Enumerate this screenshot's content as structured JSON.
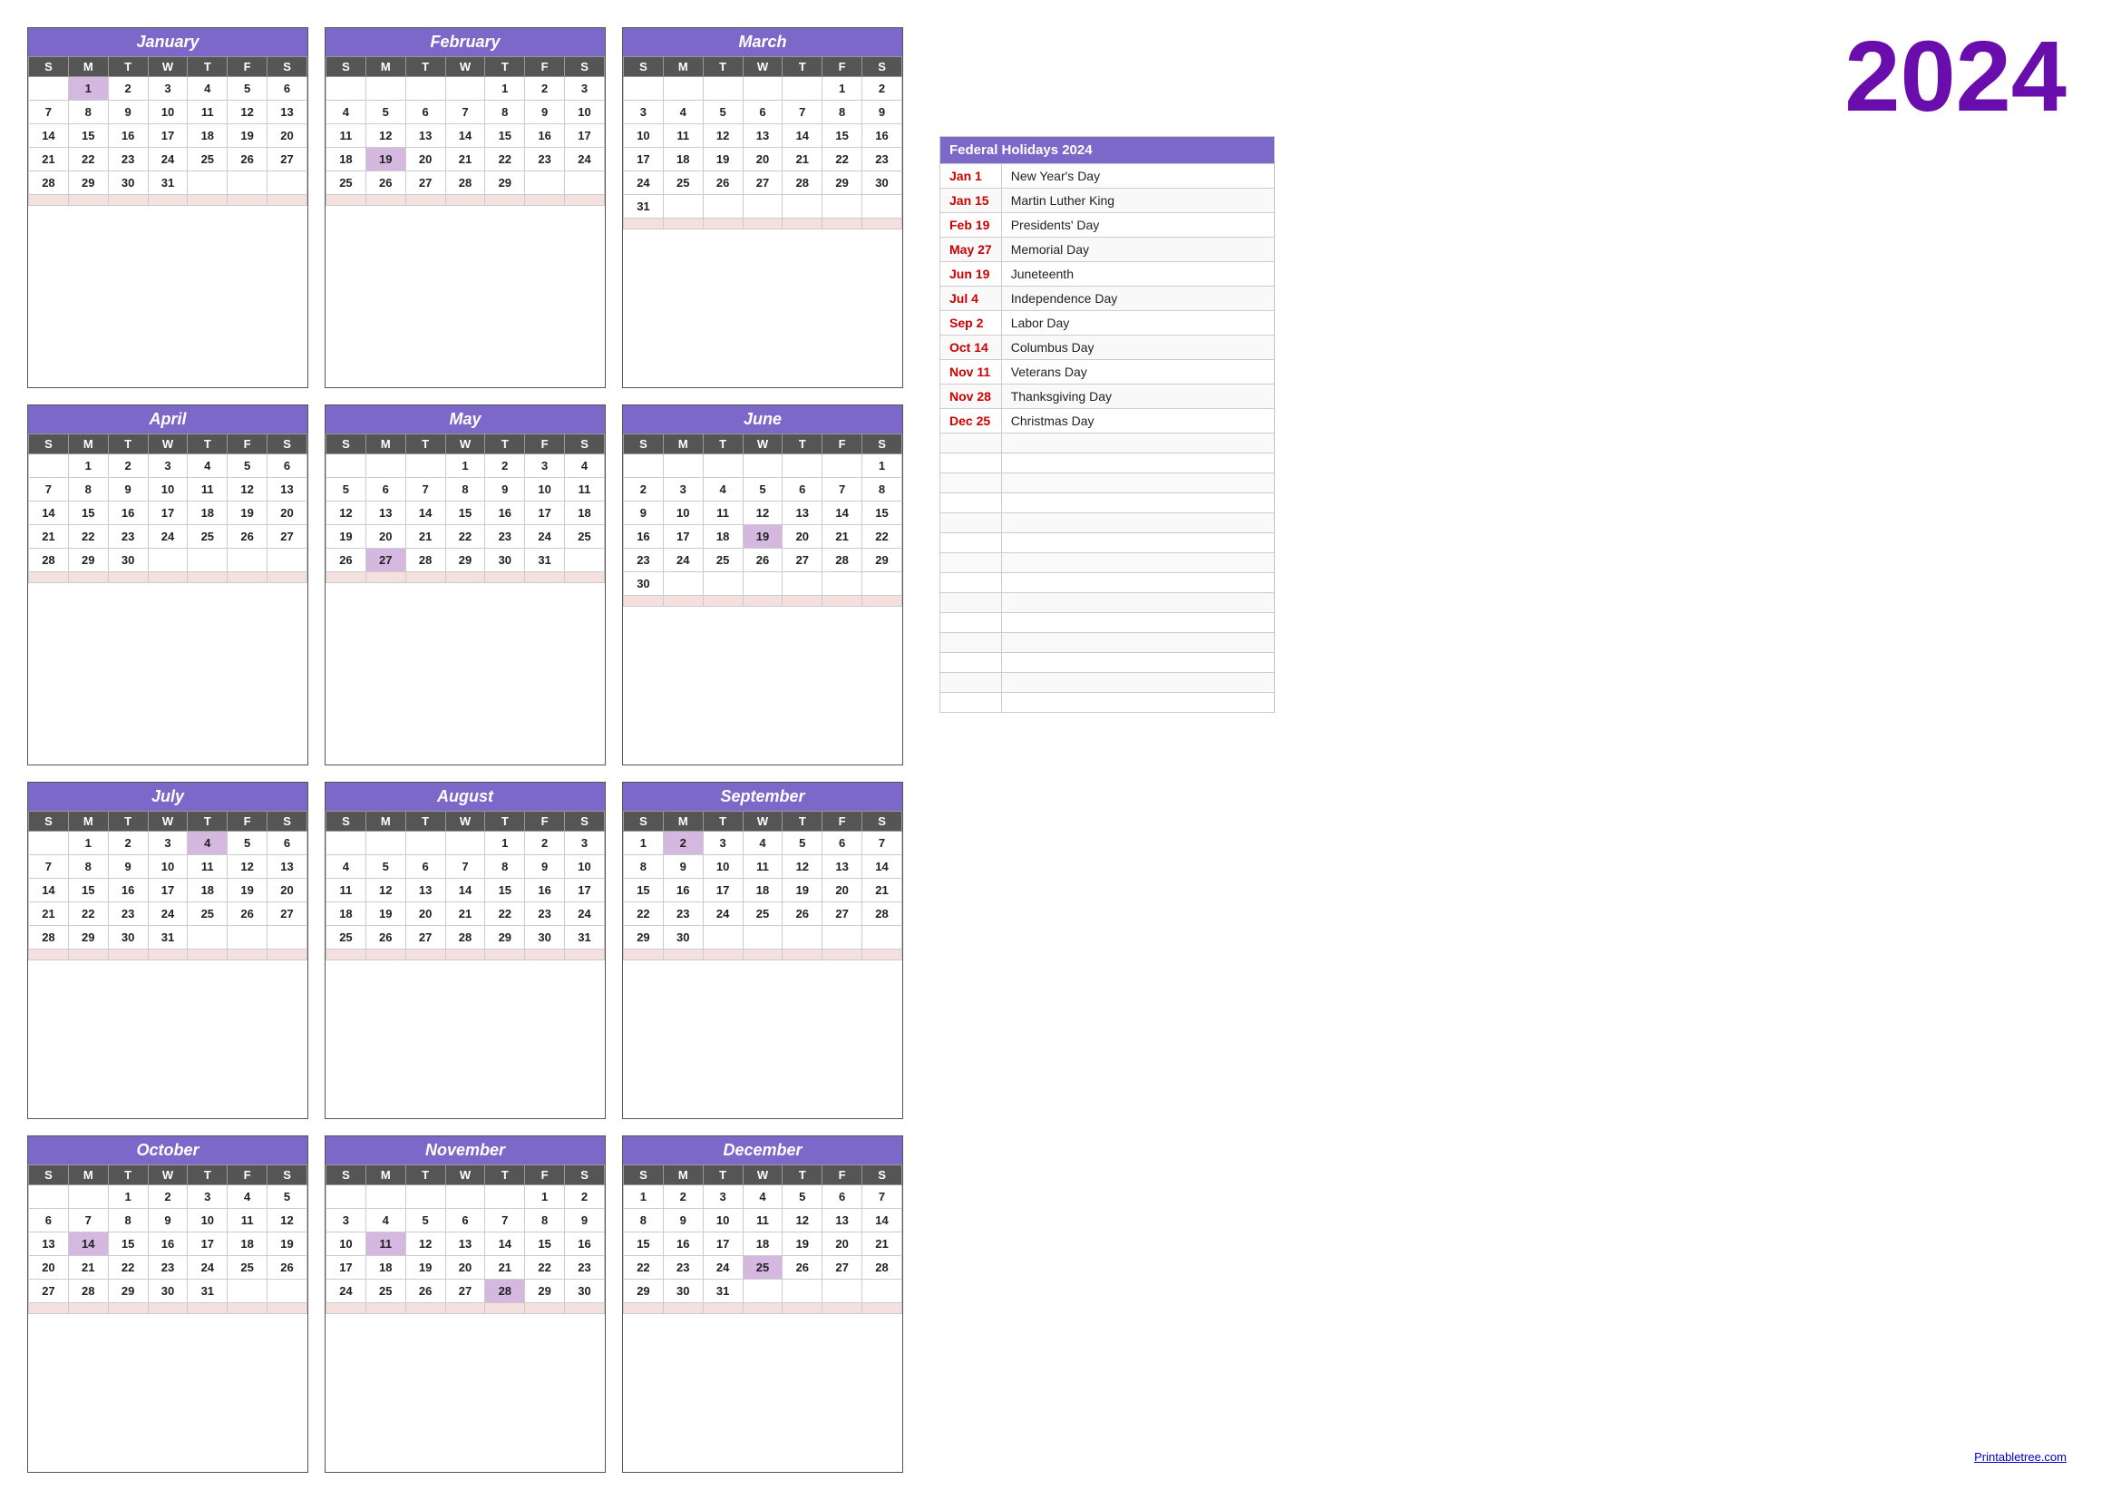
{
  "year": "2024",
  "months": [
    {
      "name": "January",
      "days": [
        [
          "",
          "1",
          "2",
          "3",
          "4",
          "5",
          "6"
        ],
        [
          "7",
          "8",
          "9",
          "10",
          "11",
          "12",
          "13"
        ],
        [
          "14",
          "15",
          "16",
          "17",
          "18",
          "19",
          "20"
        ],
        [
          "21",
          "22",
          "23",
          "24",
          "25",
          "26",
          "27"
        ],
        [
          "28",
          "29",
          "30",
          "31",
          "",
          "",
          ""
        ]
      ],
      "holidays": [
        "1"
      ]
    },
    {
      "name": "February",
      "days": [
        [
          "",
          "",
          "",
          "",
          "1",
          "2",
          "3"
        ],
        [
          "4",
          "5",
          "6",
          "7",
          "8",
          "9",
          "10"
        ],
        [
          "11",
          "12",
          "13",
          "14",
          "15",
          "16",
          "17"
        ],
        [
          "18",
          "19",
          "20",
          "21",
          "22",
          "23",
          "24"
        ],
        [
          "25",
          "26",
          "27",
          "28",
          "29",
          "",
          ""
        ]
      ],
      "holidays": [
        "19"
      ]
    },
    {
      "name": "March",
      "days": [
        [
          "",
          "",
          "",
          "",
          "",
          "1",
          "2"
        ],
        [
          "3",
          "4",
          "5",
          "6",
          "7",
          "8",
          "9"
        ],
        [
          "10",
          "11",
          "12",
          "13",
          "14",
          "15",
          "16"
        ],
        [
          "17",
          "18",
          "19",
          "20",
          "21",
          "22",
          "23"
        ],
        [
          "24",
          "25",
          "26",
          "27",
          "28",
          "29",
          "30"
        ],
        [
          "31",
          "",
          "",
          "",
          "",
          "",
          ""
        ]
      ],
      "holidays": []
    },
    {
      "name": "April",
      "days": [
        [
          "",
          "1",
          "2",
          "3",
          "4",
          "5",
          "6"
        ],
        [
          "7",
          "8",
          "9",
          "10",
          "11",
          "12",
          "13"
        ],
        [
          "14",
          "15",
          "16",
          "17",
          "18",
          "19",
          "20"
        ],
        [
          "21",
          "22",
          "23",
          "24",
          "25",
          "26",
          "27"
        ],
        [
          "28",
          "29",
          "30",
          "",
          "",
          "",
          ""
        ]
      ],
      "holidays": []
    },
    {
      "name": "May",
      "days": [
        [
          "",
          "",
          "",
          "1",
          "2",
          "3",
          "4"
        ],
        [
          "5",
          "6",
          "7",
          "8",
          "9",
          "10",
          "11"
        ],
        [
          "12",
          "13",
          "14",
          "15",
          "16",
          "17",
          "18"
        ],
        [
          "19",
          "20",
          "21",
          "22",
          "23",
          "24",
          "25"
        ],
        [
          "26",
          "27",
          "28",
          "29",
          "30",
          "31",
          ""
        ]
      ],
      "holidays": [
        "27"
      ]
    },
    {
      "name": "June",
      "days": [
        [
          "",
          "",
          "",
          "",
          "",
          "",
          "1"
        ],
        [
          "2",
          "3",
          "4",
          "5",
          "6",
          "7",
          "8"
        ],
        [
          "9",
          "10",
          "11",
          "12",
          "13",
          "14",
          "15"
        ],
        [
          "16",
          "17",
          "18",
          "19",
          "20",
          "21",
          "22"
        ],
        [
          "23",
          "24",
          "25",
          "26",
          "27",
          "28",
          "29"
        ],
        [
          "30",
          "",
          "",
          "",
          "",
          "",
          ""
        ]
      ],
      "holidays": [
        "19"
      ]
    },
    {
      "name": "July",
      "days": [
        [
          "",
          "1",
          "2",
          "3",
          "4",
          "5",
          "6"
        ],
        [
          "7",
          "8",
          "9",
          "10",
          "11",
          "12",
          "13"
        ],
        [
          "14",
          "15",
          "16",
          "17",
          "18",
          "19",
          "20"
        ],
        [
          "21",
          "22",
          "23",
          "24",
          "25",
          "26",
          "27"
        ],
        [
          "28",
          "29",
          "30",
          "31",
          "",
          "",
          ""
        ]
      ],
      "holidays": [
        "4"
      ]
    },
    {
      "name": "August",
      "days": [
        [
          "",
          "",
          "",
          "",
          "1",
          "2",
          "3"
        ],
        [
          "4",
          "5",
          "6",
          "7",
          "8",
          "9",
          "10"
        ],
        [
          "11",
          "12",
          "13",
          "14",
          "15",
          "16",
          "17"
        ],
        [
          "18",
          "19",
          "20",
          "21",
          "22",
          "23",
          "24"
        ],
        [
          "25",
          "26",
          "27",
          "28",
          "29",
          "30",
          "31"
        ]
      ],
      "holidays": []
    },
    {
      "name": "September",
      "days": [
        [
          "1",
          "2",
          "3",
          "4",
          "5",
          "6",
          "7"
        ],
        [
          "8",
          "9",
          "10",
          "11",
          "12",
          "13",
          "14"
        ],
        [
          "15",
          "16",
          "17",
          "18",
          "19",
          "20",
          "21"
        ],
        [
          "22",
          "23",
          "24",
          "25",
          "26",
          "27",
          "28"
        ],
        [
          "29",
          "30",
          "",
          "",
          "",
          "",
          ""
        ]
      ],
      "holidays": [
        "2"
      ]
    },
    {
      "name": "October",
      "days": [
        [
          "",
          "",
          "1",
          "2",
          "3",
          "4",
          "5"
        ],
        [
          "6",
          "7",
          "8",
          "9",
          "10",
          "11",
          "12"
        ],
        [
          "13",
          "14",
          "15",
          "16",
          "17",
          "18",
          "19"
        ],
        [
          "20",
          "21",
          "22",
          "23",
          "24",
          "25",
          "26"
        ],
        [
          "27",
          "28",
          "29",
          "30",
          "31",
          "",
          ""
        ]
      ],
      "holidays": [
        "14"
      ]
    },
    {
      "name": "November",
      "days": [
        [
          "",
          "",
          "",
          "",
          "",
          "1",
          "2"
        ],
        [
          "3",
          "4",
          "5",
          "6",
          "7",
          "8",
          "9"
        ],
        [
          "10",
          "11",
          "12",
          "13",
          "14",
          "15",
          "16"
        ],
        [
          "17",
          "18",
          "19",
          "20",
          "21",
          "22",
          "23"
        ],
        [
          "24",
          "25",
          "26",
          "27",
          "28",
          "29",
          "30"
        ]
      ],
      "holidays": [
        "11",
        "28"
      ]
    },
    {
      "name": "December",
      "days": [
        [
          "1",
          "2",
          "3",
          "4",
          "5",
          "6",
          "7"
        ],
        [
          "8",
          "9",
          "10",
          "11",
          "12",
          "13",
          "14"
        ],
        [
          "15",
          "16",
          "17",
          "18",
          "19",
          "20",
          "21"
        ],
        [
          "22",
          "23",
          "24",
          "25",
          "26",
          "27",
          "28"
        ],
        [
          "29",
          "30",
          "31",
          "",
          "",
          "",
          ""
        ]
      ],
      "holidays": [
        "25"
      ]
    }
  ],
  "holidays": [
    {
      "date": "Jan 1",
      "name": "New Year's Day"
    },
    {
      "date": "Jan 15",
      "name": "Martin Luther King"
    },
    {
      "date": "Feb 19",
      "name": "Presidents' Day"
    },
    {
      "date": "May 27",
      "name": "Memorial Day"
    },
    {
      "date": "Jun 19",
      "name": "Juneteenth"
    },
    {
      "date": "Jul 4",
      "name": "Independence Day"
    },
    {
      "date": "Sep 2",
      "name": "Labor Day"
    },
    {
      "date": "Oct 14",
      "name": "Columbus Day"
    },
    {
      "date": "Nov 11",
      "name": "Veterans Day"
    },
    {
      "date": "Nov 28",
      "name": "Thanksgiving Day"
    },
    {
      "date": "Dec 25",
      "name": "Christmas Day"
    }
  ],
  "footer": "Printabletree.com",
  "holidays_header": "Federal Holidays 2024",
  "weekdays": [
    "S",
    "M",
    "T",
    "W",
    "T",
    "F",
    "S"
  ]
}
